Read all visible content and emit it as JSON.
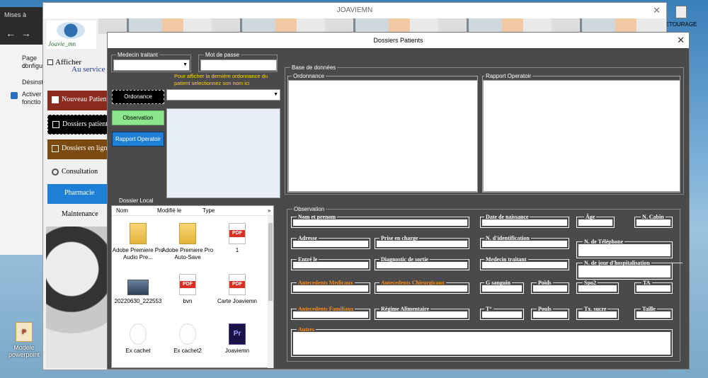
{
  "background": {
    "settings_window": {
      "title": "Mises à",
      "items": [
        "Page d'",
        "configu",
        "Désinst",
        "Activer",
        "fonctio"
      ]
    },
    "desktop_icon_left": {
      "label": "Modèle powerpoint"
    },
    "desktop_icon_right": {
      "label": "ETOURAGE"
    }
  },
  "main_window": {
    "title": "JOAVIEMN",
    "logo_text": "Joavie_mn",
    "afficher_label": "Afficher",
    "au_service": "Au service",
    "menu": [
      {
        "label": "Nouveau Patient",
        "color": "#8b2b1e"
      },
      {
        "label": "Dossiers patients",
        "color": "#000000"
      },
      {
        "label": "Dossiers en ligne",
        "color": "#7a4a10"
      },
      {
        "label": "Consultation",
        "color": "#f0f0f0"
      },
      {
        "label": "Pharmacie",
        "color": "#1e7fd6"
      },
      {
        "label": "Maintenance",
        "color": "#f0f0f0"
      }
    ]
  },
  "dialog": {
    "title": "Dossiers Patients",
    "medecin_traitant_label": "Medecin traitant",
    "mot_de_passe_label": "Mot de passe",
    "hint": "Pour afficher la dernière ordonnance du patient selectionnez son nom ici",
    "btn_ordonance": "Ordonance",
    "btn_observation": "Observation",
    "btn_rapport": "Rapport Operatoir",
    "dossier_local_label": "Dossier Local",
    "file_columns": [
      "Nom",
      "Modifié le",
      "Type"
    ],
    "files": [
      {
        "name": "Adobe Premiere Pro Audio Pre...",
        "icon": "folder-icon"
      },
      {
        "name": "Adobe Premiere Pro Auto-Save",
        "icon": "folder-icon"
      },
      {
        "name": "1",
        "icon": "pdf-icon"
      },
      {
        "name": "20220630_222553",
        "icon": "image-icon"
      },
      {
        "name": "bvn",
        "icon": "pdf-icon"
      },
      {
        "name": "Carte Joaviemn",
        "icon": "pdf-icon"
      },
      {
        "name": "Ex cachet",
        "icon": "stamp-icon"
      },
      {
        "name": "Ex cachet2",
        "icon": "stamp-icon"
      },
      {
        "name": "Joaviemn",
        "icon": "premiere-project-icon"
      }
    ],
    "pdf_badge": "PDF",
    "pr_badge": "Pr",
    "base_label": "Base de données",
    "ordonnance_label": "Ordonnance",
    "rapport_label": "Rapport Operatoir",
    "observation_label": "Observation",
    "fields": {
      "nom": "Nom et prenom",
      "naissance": "Date de naissance",
      "age": "Âge",
      "cabin": "N. Cabin",
      "adresse": "Adresse",
      "prise": "Prise en charge",
      "ident": "N. d'identification",
      "tel": "N. de Téléphone",
      "entre": "Entré le",
      "diag": "Diagnostic  de sortie",
      "medecin": "Medecin traitant",
      "jour_hosp": "N. de jour d'hospitalisation",
      "ant_med": "Antecedents Medicaux",
      "ant_chir": "Antecedents Chirurgicaux",
      "gsanguin": "G sanguin",
      "poids": "Poids",
      "spo2": "Spo2",
      "ta": "TA",
      "ant_fam": "Antecedents Familiaux",
      "regime": "Régime Alimentaire",
      "temp": "T°",
      "pouls": "Pouls",
      "sucre": "Tx. sucre",
      "taille": "Taille",
      "autres": "Autres"
    }
  }
}
